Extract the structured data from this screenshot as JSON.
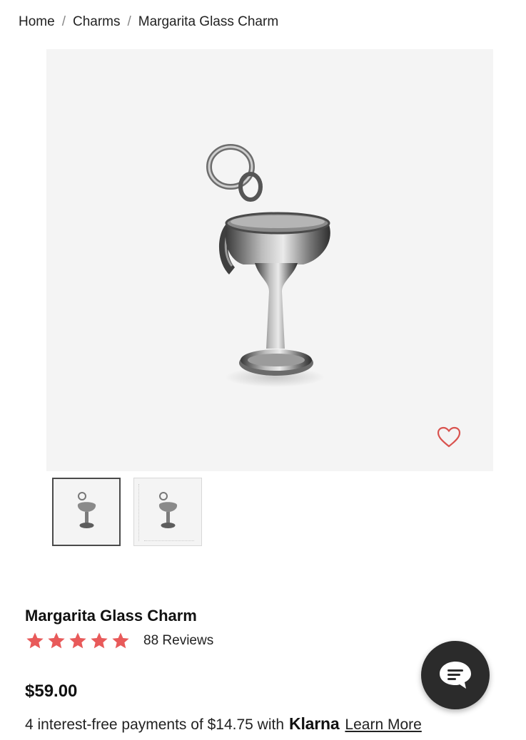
{
  "breadcrumb": {
    "items": [
      {
        "label": "Home"
      },
      {
        "label": "Charms"
      },
      {
        "label": "Margarita Glass Charm"
      }
    ],
    "separator": "/"
  },
  "gallery": {
    "main_image": "margarita-glass-charm-image",
    "thumbnails": [
      {
        "image": "charm-front-thumbnail",
        "selected": true
      },
      {
        "image": "charm-with-measurements-thumbnail",
        "selected": false
      }
    ],
    "wishlist_icon": "heart-outline-icon"
  },
  "product": {
    "title": "Margarita Glass Charm",
    "rating": 5,
    "rating_max": 5,
    "reviews_label": "88 Reviews",
    "price": "$59.00",
    "installments_text": "4 interest-free payments of $14.75 with",
    "klarna_brand": "Klarna",
    "learn_more_label": "Learn More"
  },
  "chat": {
    "icon": "chat-bubble-icon"
  },
  "colors": {
    "star": "#e85a5a",
    "heart": "#d9534f",
    "chat_bg": "#2b2b2b",
    "image_bg": "#f4f4f4"
  }
}
